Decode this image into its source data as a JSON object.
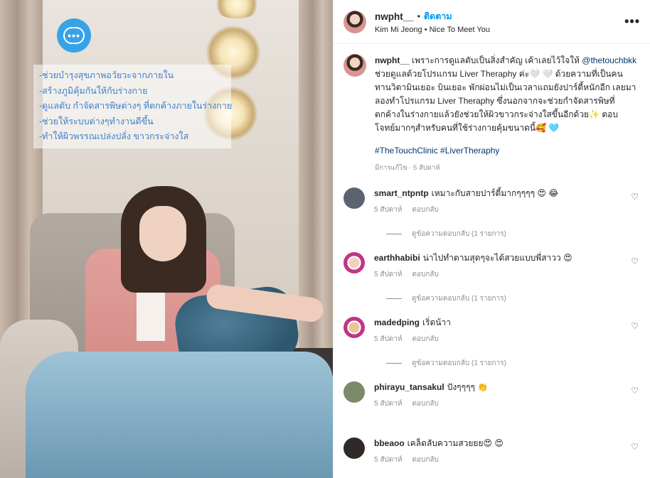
{
  "media": {
    "overlay_lines": [
      "-ช่วยบำรุงสุขภาพอวัยวะจากภายใน",
      "-สร้างภูมิคุ้มกันให้กับร่างกาย",
      "-ดูแลตับ กำจัดสารพิษต่างๆ ที่ตกค้างภายในร่างกาย",
      "-ช่วยให้ระบบต่างๆทำงานดีขึ้น",
      "-ทำให้ผิวพรรณเปล่งปลั่ง ขาวกระจ่างใส"
    ],
    "chat_icon": "chat-bubble-icon"
  },
  "header": {
    "username": "nwpht__",
    "dot": "•",
    "follow": "ติดตาม",
    "subtitle": "Kim Mi Jeong • Nice To Meet You",
    "more": "•••"
  },
  "caption": {
    "username": "nwpht__",
    "text_1": "เพราะการดูแลตับเป็นสิ่งสำคัญ เค้าเลยไว้ใจให้",
    "mention": "@thetouchbkk",
    "text_2": "ช่วยดูแลด้วยโปรแกรม Liver Theraphy ค่ะ🤍 🤍 ด้วยความที่เป็นคนทานวิตามินเยอะ บินเยอะ พักผ่อนไม่เป็นเวลาแถมยังปาร์ตี้หนักอีก เลยมาลองทำโปรแกรม Liver Theraphy ซึ่งนอกจากจะช่วยกำจัดสารพิษที่ตกค้างในร่างกายแล้วยังช่วยให้ผิวขาวกระจ่างใสขึ้นอีกด้วย✨ ตอบโจทย์มากๆสำหรับคนที่ใช้ร่างกายคุ้มขนาดนี้🥰 🩵",
    "hashtags": "#TheTouchClinic #LiverTheraphy",
    "meta": "มีการแก้ไข · 5 สัปดาห์"
  },
  "comments": [
    {
      "username": "smart_ntpntp",
      "text": "เหมาะกับสายปาร์ตี้มากๆๆๆๆ 😍 😂",
      "time": "5 สัปดาห์",
      "reply": "ตอบกลับ",
      "view_replies": "ดูข้อความตอบกลับ (1 รายการ)",
      "avatar_color": "#5a6470"
    },
    {
      "username": "earthhabibi",
      "text": "น่าไปทำตามสุดๆจะได้สวยแบบพี่สาวว 😍",
      "time": "5 สัปดาห์",
      "reply": "ตอบกลับ",
      "view_replies": "ดูข้อความตอบกลับ (1 รายการ)",
      "avatar_color": "#c13584"
    },
    {
      "username": "madedping",
      "text": "เริ่ดน้าา",
      "time": "5 สัปดาห์",
      "reply": "ตอบกลับ",
      "view_replies": "ดูข้อความตอบกลับ (1 รายการ)",
      "avatar_color": "#d6a15a"
    },
    {
      "username": "phirayu_tansakul",
      "text": "ปังๆๆๆๆ 👏",
      "time": "5 สัปดาห์",
      "reply": "ตอบกลับ",
      "view_replies": "",
      "avatar_color": "#7d8a6a"
    },
    {
      "username": "bbeaoo",
      "text": "เคล็ดลับความสวยยย😍 😍",
      "time": "5 สัปดาห์",
      "reply": "ตอบกลับ",
      "view_replies": "",
      "avatar_color": "#2f2a28"
    }
  ]
}
